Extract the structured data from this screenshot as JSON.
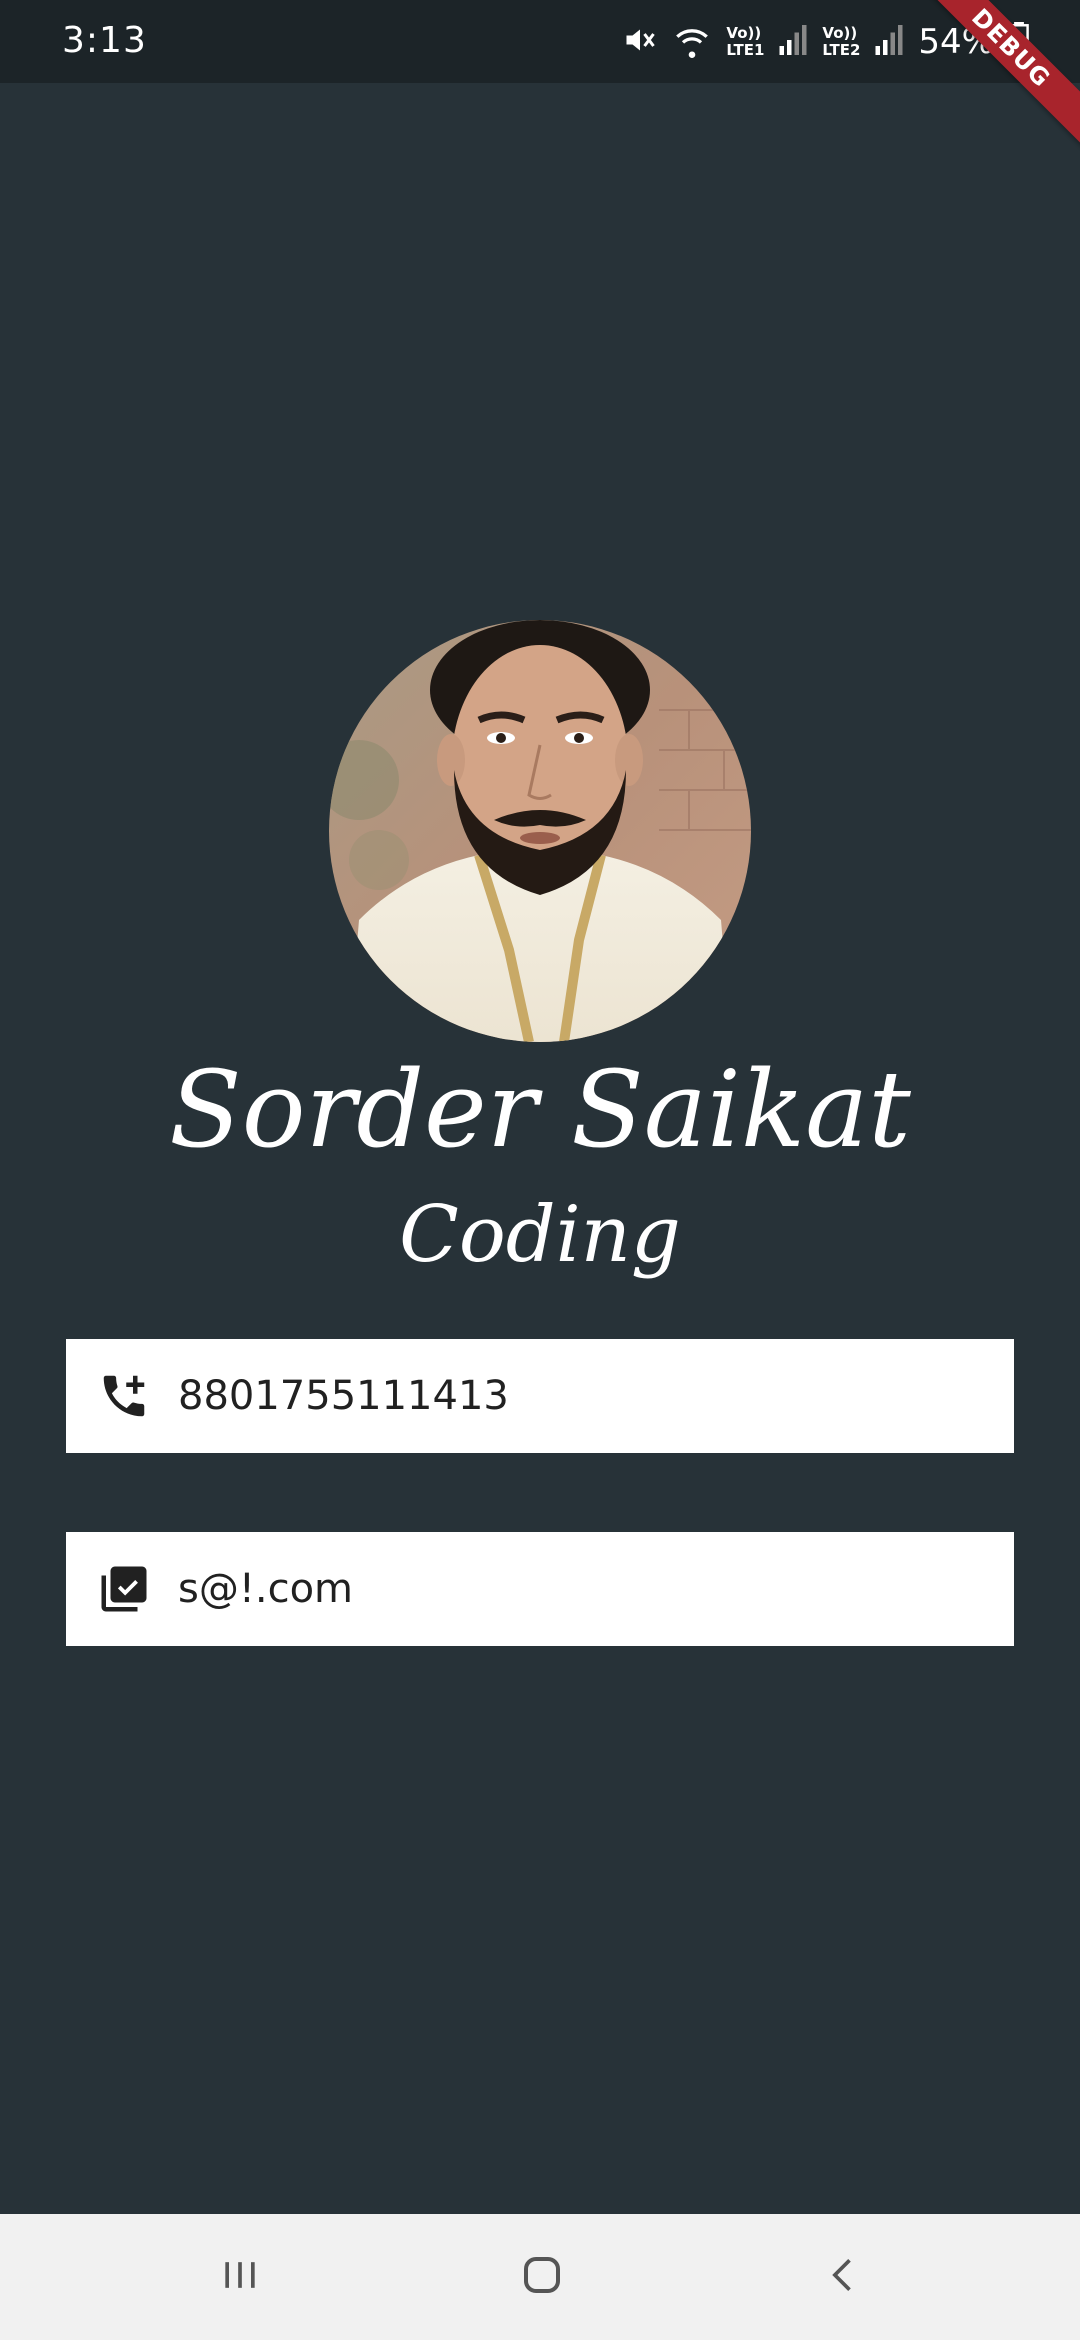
{
  "status_bar": {
    "time": "3:13",
    "network1_top": "Vo))",
    "network1_bottom": "LTE1",
    "network2_top": "Vo))",
    "network2_bottom": "LTE2",
    "battery": "54%"
  },
  "debug_banner": "DEBUG",
  "profile": {
    "name": "Sorder Saikat",
    "role": "Coding"
  },
  "contact": {
    "phone": "8801755111413",
    "email": "s@!.com"
  },
  "colors": {
    "background": "#273238",
    "card": "#ffffff",
    "debug_banner": "#a8242c",
    "nav_bar": "#f1f1f1"
  },
  "icons": {
    "phone": "add-call-icon",
    "email": "library-add-check-icon",
    "nav_recents": "recents-icon",
    "nav_home": "home-icon",
    "nav_back": "back-icon"
  }
}
